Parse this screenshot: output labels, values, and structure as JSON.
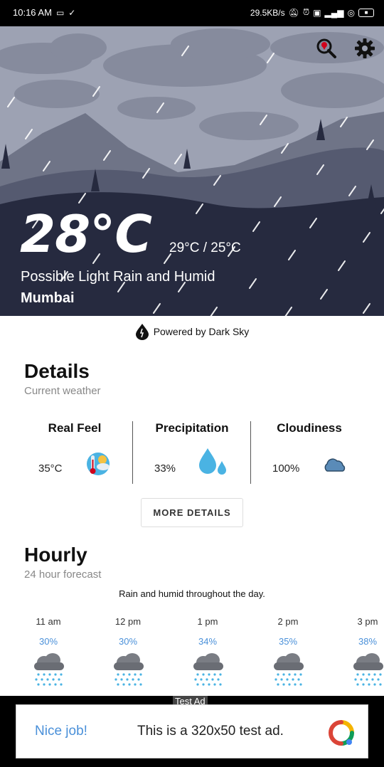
{
  "status_bar": {
    "time": "10:16 AM",
    "speed": "29.5KB/s"
  },
  "hero": {
    "temperature": "28°C",
    "range": "29°C / 25°C",
    "summary": "Possible Light Rain and Humid",
    "city": "Mumbai"
  },
  "powered_by": "Powered by Dark Sky",
  "details": {
    "title": "Details",
    "subtitle": "Current weather",
    "items": [
      {
        "label": "Real Feel",
        "value": "35°C",
        "icon": "thermometer-sun-icon"
      },
      {
        "label": "Precipitation",
        "value": "33%",
        "icon": "water-drops-icon"
      },
      {
        "label": "Cloudiness",
        "value": "100%",
        "icon": "cloud-icon"
      }
    ],
    "more_button": "MORE DETAILS"
  },
  "hourly": {
    "title": "Hourly",
    "subtitle": "24 hour forecast",
    "summary": "Rain and humid throughout the day.",
    "hours": [
      {
        "time": "11 am",
        "precip": "30%"
      },
      {
        "time": "12 pm",
        "precip": "30%"
      },
      {
        "time": "1 pm",
        "precip": "34%"
      },
      {
        "time": "2 pm",
        "precip": "35%"
      },
      {
        "time": "3 pm",
        "precip": "38%"
      }
    ]
  },
  "ad": {
    "label": "Test Ad",
    "left_text": "Nice job!",
    "main_text": "This is a 320x50 test ad."
  },
  "colors": {
    "sky": "#9da2b3",
    "ground": "#262a3f",
    "accent_blue": "#4a90d9"
  }
}
